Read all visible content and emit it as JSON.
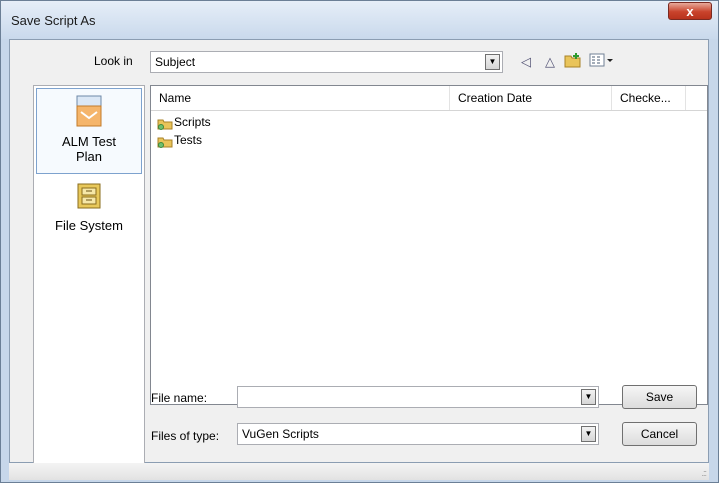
{
  "window": {
    "title": "Save Script As",
    "close_glyph": "x"
  },
  "lookin": {
    "label": "Look in",
    "value": "Subject"
  },
  "toolbar": [
    {
      "name": "back-icon",
      "glyph": "◁"
    },
    {
      "name": "up-folder-icon",
      "glyph": "△"
    },
    {
      "name": "new-folder-icon",
      "glyph": ""
    },
    {
      "name": "view-menu-icon",
      "glyph": ""
    }
  ],
  "places": [
    {
      "label": "ALM Test Plan",
      "icon": "alm-test-plan-icon"
    },
    {
      "label": "File System",
      "icon": "file-system-icon"
    }
  ],
  "filelist": {
    "columns": [
      "Name",
      "Creation Date",
      "Checke..."
    ],
    "rows": [
      {
        "name": "Scripts",
        "icon": "folder-icon"
      },
      {
        "name": "Tests",
        "icon": "folder-icon"
      }
    ]
  },
  "filename": {
    "label": "File name:",
    "value": ""
  },
  "filetype": {
    "label": "Files of type:",
    "value": "VuGen Scripts"
  },
  "buttons": {
    "save": "Save",
    "cancel": "Cancel"
  },
  "colors": {
    "title_bg": "#c9d9ec",
    "close_red": "#c9432c",
    "selection_border": "#7da2ce"
  }
}
